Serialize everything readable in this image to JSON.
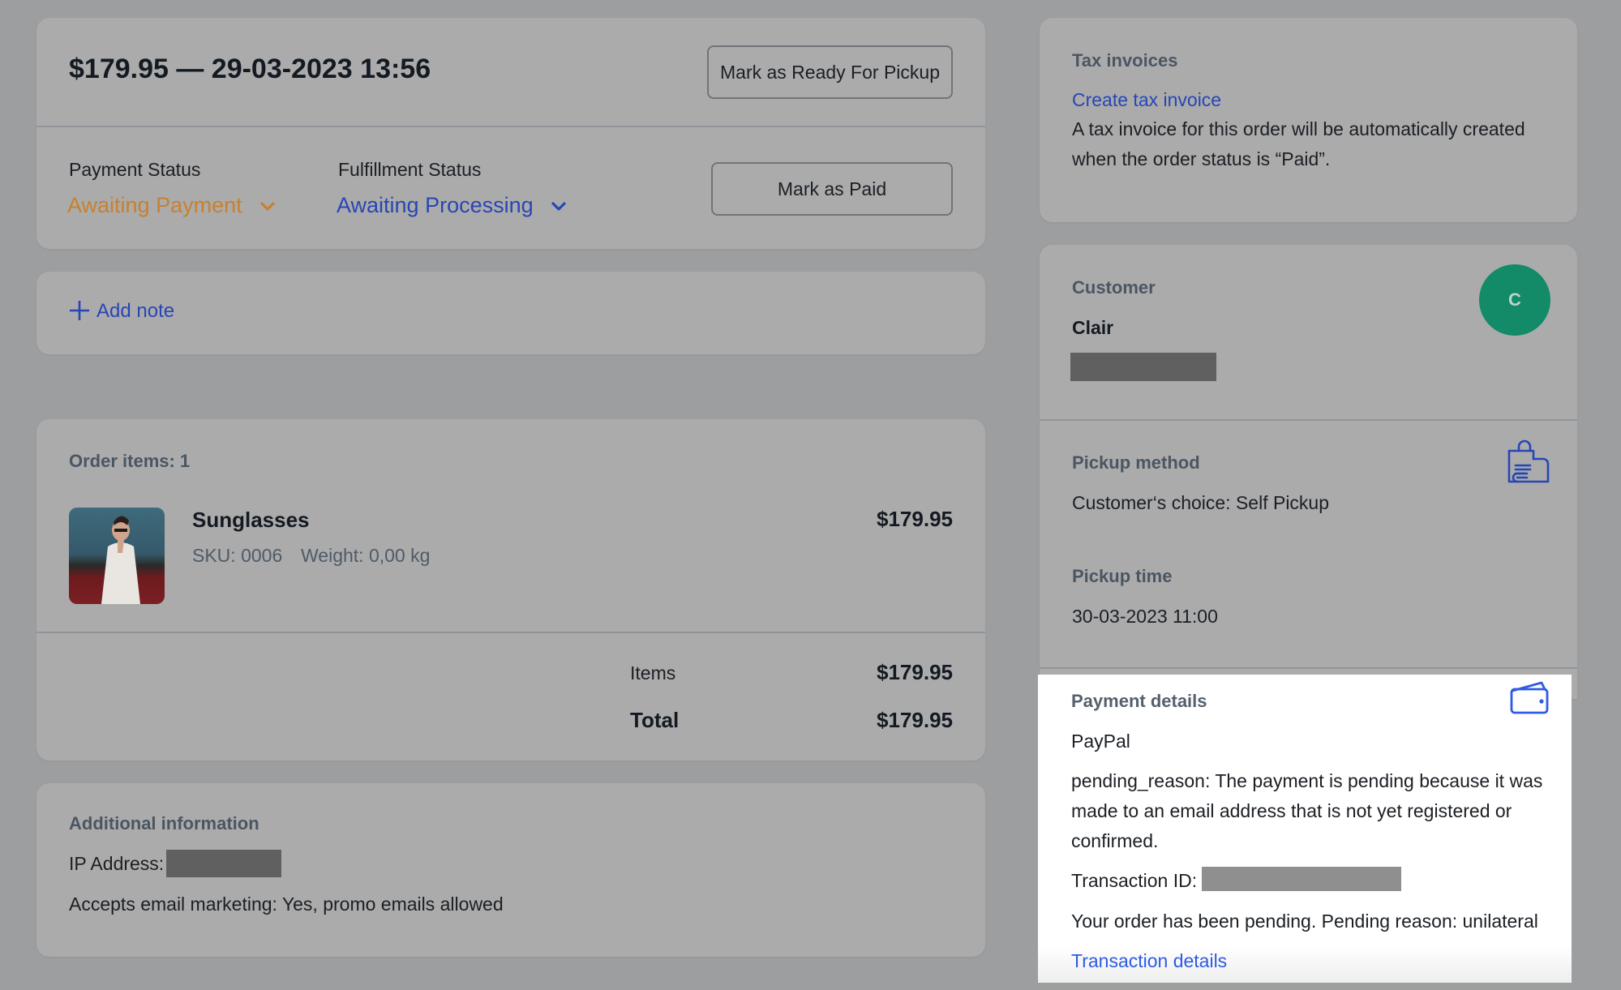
{
  "order": {
    "title": "$179.95 — 29-03-2023 13:56",
    "ready_pickup_button": "Mark as Ready For Pickup",
    "payment_status_label": "Payment Status",
    "payment_status_value": "Awaiting Payment",
    "fulfillment_status_label": "Fulfillment Status",
    "fulfillment_status_value": "Awaiting Processing",
    "mark_paid_button": "Mark as Paid",
    "colors": {
      "payment_status": "#c7812f",
      "fulfillment_status": "#2746b5"
    }
  },
  "note": {
    "add_note_label": "Add note",
    "icon": "plus-icon"
  },
  "items": {
    "heading": "Order items: 1",
    "list": [
      {
        "name": "Sunglasses",
        "sku": "SKU: 0006",
        "weight": "Weight: 0,00 kg",
        "price": "$179.95"
      }
    ],
    "summary": {
      "items_label": "Items",
      "items_value": "$179.95",
      "total_label": "Total",
      "total_value": "$179.95"
    }
  },
  "additional": {
    "heading": "Additional information",
    "ip_label": "IP Address:",
    "marketing": "Accepts email marketing: Yes, promo emails allowed"
  },
  "tax": {
    "heading": "Tax invoices",
    "create_link": "Create tax invoice",
    "note_line1": "A tax invoice for this order will be automatically created",
    "note_line2": "when the order status is “Paid”."
  },
  "customer": {
    "heading": "Customer",
    "name": "Clair",
    "avatar_initial": "C",
    "avatar_color": "#138a68"
  },
  "pickup": {
    "method_heading": "Pickup method",
    "method_value": "Customer‘s choice: Self Pickup",
    "time_heading": "Pickup time",
    "time_value": "30-03-2023 11:00",
    "icon": "shopping-bag-hand-icon"
  },
  "payment": {
    "heading": "Payment details",
    "icon": "wallet-icon",
    "method": "PayPal",
    "reason_line1": "pending_reason: The payment is pending because it was",
    "reason_line2": "made to an email address that is not yet registered or",
    "reason_line3": "confirmed.",
    "transaction_label": "Transaction ID:",
    "pending_note": "Your order has been pending. Pending reason: unilateral",
    "details_link": "Transaction details"
  }
}
